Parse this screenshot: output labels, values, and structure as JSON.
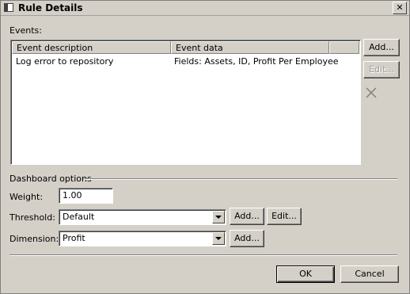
{
  "window": {
    "title": "Rule Details"
  },
  "events": {
    "label": "Events:",
    "columns": [
      "Event description",
      "Event data"
    ],
    "rows": [
      {
        "description": "Log error to repository",
        "data": "Fields: Assets, ID, Profit Per Employee"
      }
    ],
    "add_label": "Add...",
    "edit_label": "Edit..."
  },
  "dashboard": {
    "section_label": "Dashboard options",
    "weight_label": "Weight:",
    "weight_value": "1.00",
    "threshold_label": "Threshold:",
    "threshold_value": "Default",
    "threshold_add": "Add...",
    "threshold_edit": "Edit...",
    "dimension_label": "Dimension:",
    "dimension_value": "Profit",
    "dimension_add": "Add..."
  },
  "footer": {
    "ok_label": "OK",
    "cancel_label": "Cancel"
  }
}
